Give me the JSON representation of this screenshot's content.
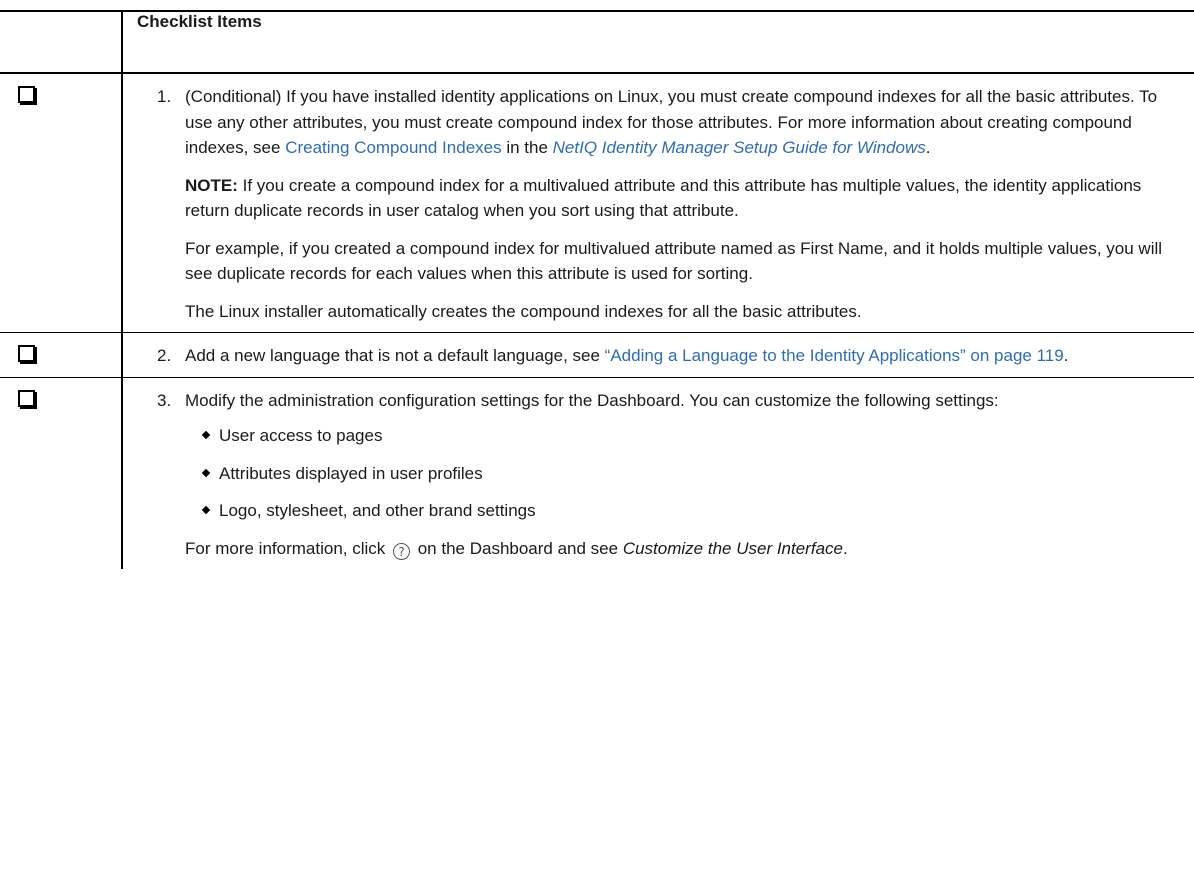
{
  "header": {
    "col_items": "Checklist Items"
  },
  "items": [
    {
      "number": "1.",
      "p1": {
        "before": "(Conditional) If you have installed identity applications on Linux, you must create compound indexes for all the basic attributes. To use any other attributes, you must create compound index for those attributes. For more information about creating compound indexes, see ",
        "link1": "Creating Compound Indexes",
        "middle": " in the ",
        "link2": "NetIQ Identity Manager Setup Guide for Windows",
        "after": "."
      },
      "note_label": "NOTE:",
      "note_text": " If you create a compound index for a multivalued attribute and this attribute has multiple values, the identity applications return duplicate records in user catalog when you sort using that attribute.",
      "p3": "For example, if you created a compound index for multivalued attribute named as First Name, and it holds multiple values, you will see duplicate records for each values when this attribute is used for sorting.",
      "p4": "The Linux installer automatically creates the compound indexes for all the basic attributes."
    },
    {
      "number": "2.",
      "before": "Add a new language that is not a default language, see ",
      "link": "“Adding a Language to the Identity Applications” on page 119",
      "after": "."
    },
    {
      "number": "3.",
      "intro": "Modify the administration configuration settings for the Dashboard. You can customize the following settings:",
      "bullets": [
        "User access to pages",
        "Attributes displayed in user profiles",
        "Logo, stylesheet, and other brand settings"
      ],
      "outro_before": "For more information, click ",
      "help_icon": "help-circle-icon",
      "help_glyph": "?",
      "outro_middle": " on the Dashboard and see ",
      "outro_italic": "Customize the User Interface",
      "outro_after": "."
    }
  ],
  "colors": {
    "link": "#2e6db4",
    "border": "#000000"
  }
}
